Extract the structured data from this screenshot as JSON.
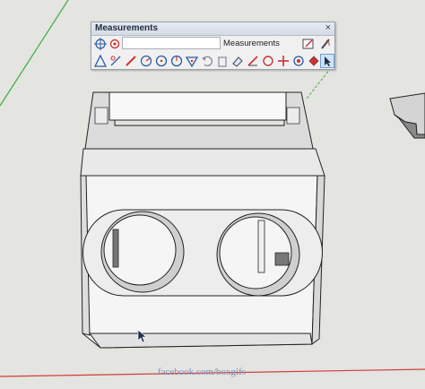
{
  "toolbar": {
    "title": "Measurements",
    "close_glyph": "×",
    "input_value": "",
    "label": "Measurements",
    "row1_icons": [
      "crosshair-icon",
      "pin-icon",
      "measure-extent-icon",
      "pencil-icon"
    ],
    "row2_icons": [
      "tape-measure-icon",
      "dimension-icon",
      "protractor-icon",
      "axes-icon",
      "circle-icon",
      "arc-icon",
      "polygon-icon",
      "undo-icon",
      "delete-icon",
      "eraser-icon",
      "rotate-icon",
      "refresh-icon",
      "move-icon",
      "component-icon",
      "paint-bucket-icon",
      "select-arrow-icon"
    ]
  },
  "watermark": "facebook.com/boxgifs",
  "colors": {
    "background": "#e4e4e0",
    "green_axis": "#3fae3f",
    "red_axis": "#d23c3c",
    "box_face": "#f4f4f4",
    "box_side": "#e6e6e6",
    "toolbar_selected": "#cfe3fb"
  }
}
